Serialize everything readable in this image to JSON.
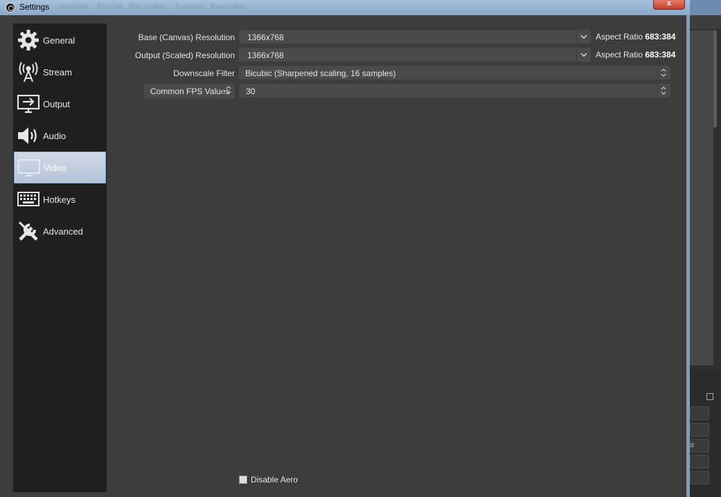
{
  "window": {
    "title": "Settings",
    "subtitle_blurred": "untitled - Profile: Recorder - Scenes: Recorder",
    "close_label": "x"
  },
  "sidebar": {
    "items": [
      {
        "label": "General",
        "icon": "gear-icon"
      },
      {
        "label": "Stream",
        "icon": "antenna-icon"
      },
      {
        "label": "Output",
        "icon": "monitor-output-icon"
      },
      {
        "label": "Audio",
        "icon": "speaker-icon"
      },
      {
        "label": "Video",
        "icon": "monitor-icon",
        "active": true
      },
      {
        "label": "Hotkeys",
        "icon": "keyboard-icon"
      },
      {
        "label": "Advanced",
        "icon": "tools-icon"
      }
    ]
  },
  "video": {
    "base_resolution": {
      "label": "Base (Canvas) Resolution",
      "value": "1366x768",
      "aspect_label": "Aspect Ratio",
      "aspect_value": "683:384"
    },
    "output_resolution": {
      "label": "Output (Scaled) Resolution",
      "value": "1366x768",
      "aspect_label": "Aspect Ratio",
      "aspect_value": "683:384"
    },
    "downscale_filter": {
      "label": "Downscale Filter",
      "value": "Bicubic (Sharpened scaling, 16 samples)"
    },
    "fps": {
      "type_label": "Common FPS Values",
      "value": "30"
    },
    "disable_aero": {
      "label": "Disable Aero",
      "checked": false
    }
  },
  "background": {
    "partial_text": "a"
  },
  "colors": {
    "dialog_bg": "#3c3c3c",
    "sidebar_bg": "#1f1f1f",
    "active_item": "#c4d2e3",
    "titlebar": "#9db6d4",
    "close_button": "#d45a44"
  }
}
